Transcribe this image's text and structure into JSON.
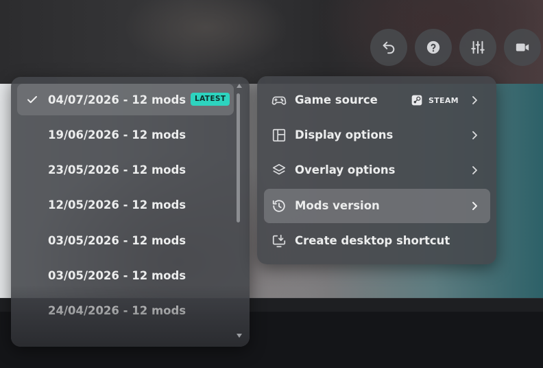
{
  "versions": {
    "items": [
      {
        "label": "04/07/2026 - 12 mods",
        "selected": true
      },
      {
        "label": "19/06/2026 - 12 mods"
      },
      {
        "label": "23/05/2026 - 12 mods"
      },
      {
        "label": "12/05/2026 - 12 mods"
      },
      {
        "label": "03/05/2026 - 12 mods"
      },
      {
        "label": "03/05/2026 - 12 mods"
      },
      {
        "label": "24/04/2026 - 12 mods"
      }
    ],
    "latest_badge": "LATEST"
  },
  "menu": {
    "items": [
      {
        "label": "Game source",
        "icon": "gamepad-icon",
        "source": "STEAM"
      },
      {
        "label": "Display options",
        "icon": "layout-icon"
      },
      {
        "label": "Overlay options",
        "icon": "layers-icon"
      },
      {
        "label": "Mods version",
        "icon": "history-icon",
        "active": true
      },
      {
        "label": "Create desktop shortcut",
        "icon": "download-monitor-icon"
      }
    ]
  },
  "toolbar": [
    "undo-icon",
    "help-icon",
    "sliders-icon",
    "video-icon"
  ],
  "colors": {
    "accent": "#2dd4bf",
    "panel": "#46484c"
  }
}
